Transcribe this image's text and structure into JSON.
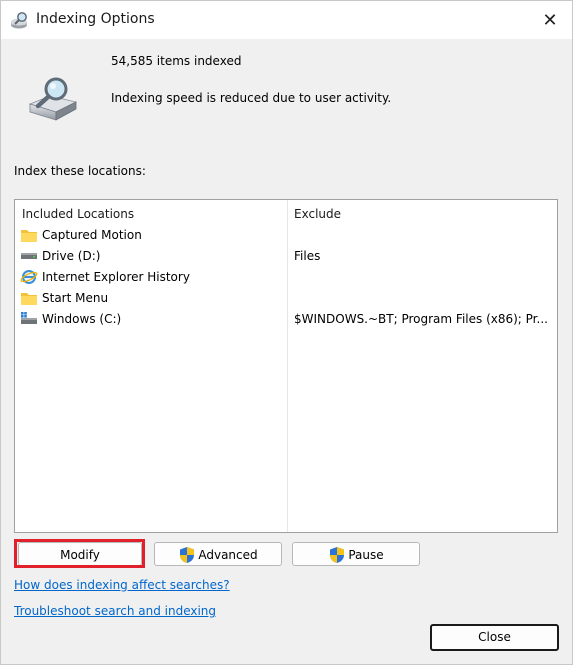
{
  "window": {
    "title": "Indexing Options",
    "close_glyph": "✕"
  },
  "status": {
    "items_indexed": "54,585 items indexed",
    "speed_message": "Indexing speed is reduced due to user activity."
  },
  "locations_label": "Index these locations:",
  "list": {
    "col_included": "Included Locations",
    "col_exclude": "Exclude",
    "rows": [
      {
        "name": "Captured Motion",
        "exclude": "",
        "icon": "folder-icon"
      },
      {
        "name": "Drive (D:)",
        "exclude": "Files",
        "icon": "drive-icon"
      },
      {
        "name": "Internet Explorer History",
        "exclude": "",
        "icon": "internet-explorer-icon"
      },
      {
        "name": "Start Menu",
        "exclude": "",
        "icon": "folder-icon"
      },
      {
        "name": "Windows (C:)",
        "exclude": "$WINDOWS.~BT; Program Files (x86); Pr...",
        "icon": "windows-drive-icon"
      }
    ]
  },
  "buttons": {
    "modify": "Modify",
    "advanced": "Advanced",
    "pause": "Pause",
    "close": "Close"
  },
  "links": {
    "how_affect": "How does indexing affect searches?",
    "troubleshoot": "Troubleshoot search and indexing"
  },
  "colors": {
    "highlight": "#e0202a",
    "link": "#0066cc"
  }
}
